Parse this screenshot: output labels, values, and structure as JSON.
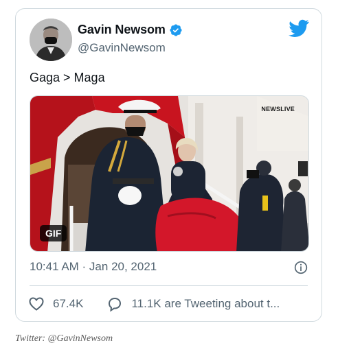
{
  "tweet": {
    "display_name": "Gavin Newsom",
    "handle": "@GavinNewsom",
    "text": "Gaga > Maga",
    "timestamp": "10:41 AM · Jan 20, 2021",
    "media": {
      "badge": "GIF",
      "logo": "NEWSLIVE"
    },
    "stats": {
      "likes": "67.4K",
      "replies_text": "11.1K are Tweeting about t..."
    }
  },
  "caption": "Twitter: @GavinNewsom",
  "colors": {
    "twitter_blue": "#1d9bf0",
    "muted_text": "#536471",
    "border": "#cfd9de"
  },
  "icons": [
    "twitter-bird-icon",
    "verified-badge-icon",
    "info-icon",
    "heart-icon",
    "reply-bubble-icon"
  ]
}
